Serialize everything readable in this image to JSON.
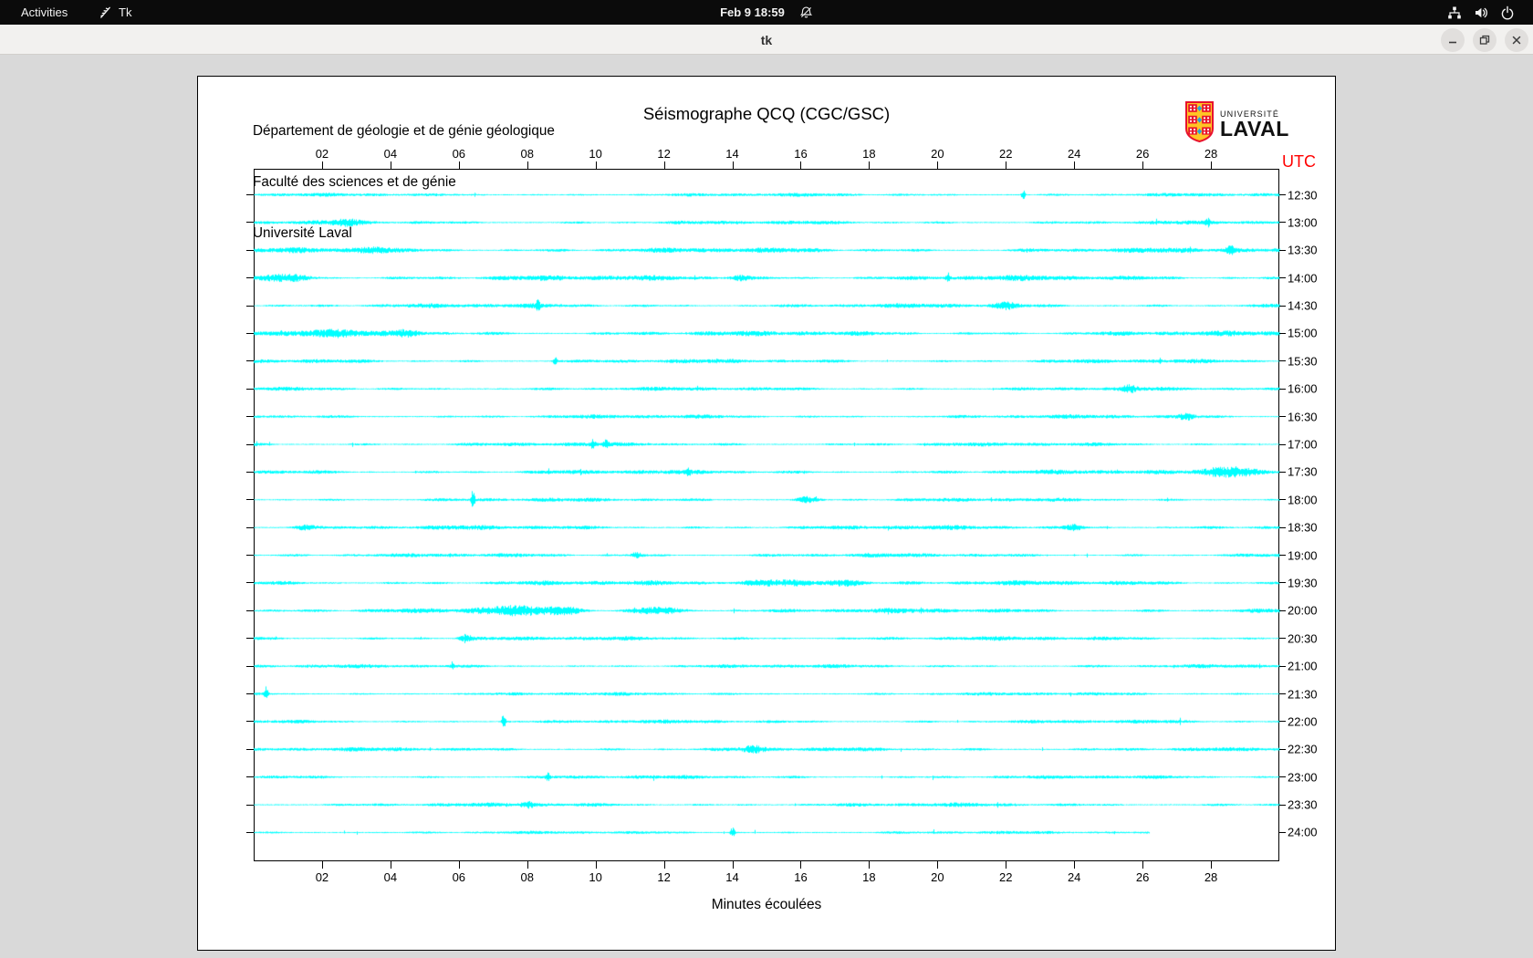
{
  "topbar": {
    "activities_label": "Activities",
    "app_name": "Tk",
    "clock": "Feb 9 18:59"
  },
  "titlebar": {
    "title": "tk"
  },
  "seismograph": {
    "header_lines": [
      "Département de géologie et de génie géologique",
      "Faculté des sciences et de génie",
      "Université Laval"
    ],
    "title": "Séismographe QCQ (CGC/GSC)",
    "utc_label": "UTC",
    "xlabel": "Minutes écoulées",
    "logo": {
      "institution_small": "UNIVERSITÉ",
      "institution_large": "LAVAL"
    }
  },
  "chart_data": {
    "type": "line",
    "title": "Séismographe QCQ (CGC/GSC)",
    "xlabel": "Minutes écoulées",
    "x_range": [
      0,
      30
    ],
    "x_ticks": [
      "02",
      "04",
      "06",
      "08",
      "10",
      "12",
      "14",
      "16",
      "18",
      "20",
      "22",
      "24",
      "26",
      "28"
    ],
    "trace_color": "#00ffff",
    "utc_color": "#ff0000",
    "legend_position": "right",
    "grid": false,
    "rows": [
      {
        "label": "12:30",
        "amp": 2.2,
        "end_minute": 30
      },
      {
        "label": "13:00",
        "amp": 2.4,
        "end_minute": 30
      },
      {
        "label": "13:30",
        "amp": 3.2,
        "end_minute": 30
      },
      {
        "label": "14:00",
        "amp": 3.4,
        "end_minute": 30
      },
      {
        "label": "14:30",
        "amp": 2.8,
        "end_minute": 30
      },
      {
        "label": "15:00",
        "amp": 3.2,
        "end_minute": 30
      },
      {
        "label": "15:30",
        "amp": 2.6,
        "end_minute": 30
      },
      {
        "label": "16:00",
        "amp": 2.4,
        "end_minute": 30
      },
      {
        "label": "16:30",
        "amp": 2.5,
        "end_minute": 30
      },
      {
        "label": "17:00",
        "amp": 2.5,
        "end_minute": 30
      },
      {
        "label": "17:30",
        "amp": 2.8,
        "end_minute": 30
      },
      {
        "label": "18:00",
        "amp": 2.4,
        "end_minute": 30
      },
      {
        "label": "18:30",
        "amp": 2.8,
        "end_minute": 30
      },
      {
        "label": "19:00",
        "amp": 2.5,
        "end_minute": 30
      },
      {
        "label": "19:30",
        "amp": 3.0,
        "end_minute": 30
      },
      {
        "label": "20:00",
        "amp": 3.0,
        "end_minute": 30
      },
      {
        "label": "20:30",
        "amp": 2.6,
        "end_minute": 30
      },
      {
        "label": "21:00",
        "amp": 2.3,
        "end_minute": 30
      },
      {
        "label": "21:30",
        "amp": 2.1,
        "end_minute": 30
      },
      {
        "label": "22:00",
        "amp": 2.3,
        "end_minute": 30
      },
      {
        "label": "22:30",
        "amp": 2.5,
        "end_minute": 30
      },
      {
        "label": "23:00",
        "amp": 2.3,
        "end_minute": 30
      },
      {
        "label": "23:30",
        "amp": 2.5,
        "end_minute": 30
      },
      {
        "label": "24:00",
        "amp": 1.9,
        "end_minute": 26.2
      }
    ],
    "events": [
      {
        "row": 0,
        "minute": 22.5,
        "width": 0.05,
        "amp": 6
      },
      {
        "row": 1,
        "minute": 2.7,
        "width": 0.4,
        "amp": 3
      },
      {
        "row": 1,
        "minute": 27.9,
        "width": 0.07,
        "amp": 4
      },
      {
        "row": 2,
        "minute": 3.5,
        "width": 0.5,
        "amp": 3
      },
      {
        "row": 2,
        "minute": 28.6,
        "width": 0.15,
        "amp": 4
      },
      {
        "row": 3,
        "minute": 0.9,
        "width": 0.8,
        "amp": 3
      },
      {
        "row": 3,
        "minute": 14.2,
        "width": 0.3,
        "amp": 3
      },
      {
        "row": 3,
        "minute": 20.3,
        "width": 0.06,
        "amp": 5
      },
      {
        "row": 4,
        "minute": 8.3,
        "width": 0.06,
        "amp": 5
      },
      {
        "row": 4,
        "minute": 22.0,
        "width": 0.3,
        "amp": 3
      },
      {
        "row": 5,
        "minute": 2.2,
        "width": 0.8,
        "amp": 3
      },
      {
        "row": 5,
        "minute": 4.5,
        "width": 0.4,
        "amp": 3
      },
      {
        "row": 6,
        "minute": 8.8,
        "width": 0.06,
        "amp": 5
      },
      {
        "row": 7,
        "minute": 25.6,
        "width": 0.2,
        "amp": 3
      },
      {
        "row": 8,
        "minute": 27.3,
        "width": 0.25,
        "amp": 3
      },
      {
        "row": 9,
        "minute": 9.9,
        "width": 0.07,
        "amp": 5
      },
      {
        "row": 9,
        "minute": 10.3,
        "width": 0.07,
        "amp": 4
      },
      {
        "row": 10,
        "minute": 12.7,
        "width": 0.06,
        "amp": 4
      },
      {
        "row": 10,
        "minute": 28.6,
        "width": 0.8,
        "amp": 6
      },
      {
        "row": 11,
        "minute": 6.4,
        "width": 0.05,
        "amp": 12
      },
      {
        "row": 11,
        "minute": 16.2,
        "width": 0.3,
        "amp": 3
      },
      {
        "row": 12,
        "minute": 1.5,
        "width": 0.3,
        "amp": 3
      },
      {
        "row": 12,
        "minute": 24.0,
        "width": 0.25,
        "amp": 3
      },
      {
        "row": 13,
        "minute": 11.2,
        "width": 0.2,
        "amp": 3
      },
      {
        "row": 14,
        "minute": 15.5,
        "width": 1.2,
        "amp": 3
      },
      {
        "row": 14,
        "minute": 17.3,
        "width": 0.5,
        "amp": 3.5
      },
      {
        "row": 15,
        "minute": 7.5,
        "width": 0.9,
        "amp": 4
      },
      {
        "row": 15,
        "minute": 9.0,
        "width": 0.5,
        "amp": 4
      },
      {
        "row": 15,
        "minute": 11.8,
        "width": 0.7,
        "amp": 3.5
      },
      {
        "row": 16,
        "minute": 6.2,
        "width": 0.2,
        "amp": 3
      },
      {
        "row": 17,
        "minute": 5.8,
        "width": 0.06,
        "amp": 4
      },
      {
        "row": 18,
        "minute": 0.35,
        "width": 0.05,
        "amp": 8
      },
      {
        "row": 19,
        "minute": 7.3,
        "width": 0.06,
        "amp": 8
      },
      {
        "row": 20,
        "minute": 14.6,
        "width": 0.3,
        "amp": 3
      },
      {
        "row": 21,
        "minute": 8.6,
        "width": 0.07,
        "amp": 4
      },
      {
        "row": 22,
        "minute": 8.0,
        "width": 0.2,
        "amp": 3
      },
      {
        "row": 23,
        "minute": 14.0,
        "width": 0.06,
        "amp": 6
      }
    ]
  }
}
